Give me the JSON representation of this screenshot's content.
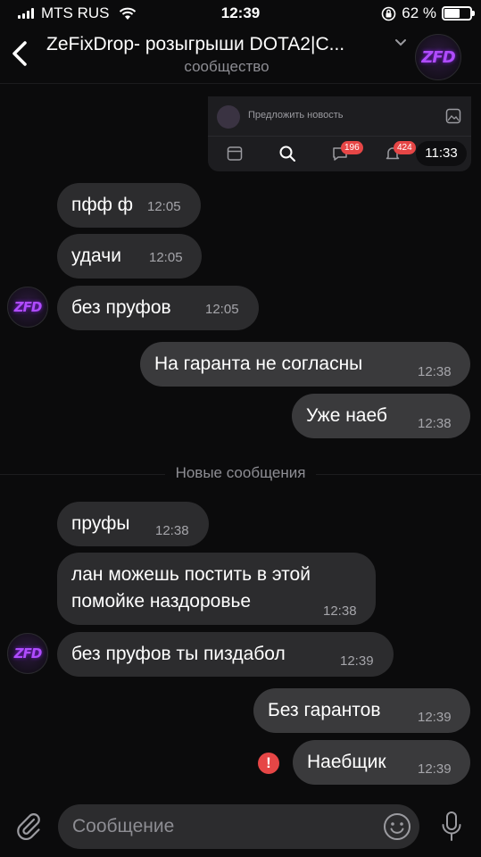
{
  "status_bar": {
    "carrier": "MTS RUS",
    "time": "12:39",
    "battery": "62 %",
    "battery_level": 0.62
  },
  "header": {
    "title": "ZeFixDrop- розыгрыши DOTA2|С...",
    "subtitle": "сообщество",
    "avatar_text": "ZFD"
  },
  "embedded_screenshot": {
    "suggest_news": "Предложить новость",
    "badge_messages": "196",
    "badge_notifications": "424",
    "time": "11:33"
  },
  "messages": [
    {
      "dir": "in",
      "text": "пфф ф",
      "time": "12:05"
    },
    {
      "dir": "in",
      "text": "удачи",
      "time": "12:05"
    },
    {
      "dir": "in",
      "text": "без пруфов",
      "time": "12:05"
    },
    {
      "dir": "out",
      "text": "На гаранта не согласны",
      "time": "12:38"
    },
    {
      "dir": "out",
      "text": "Уже наеб",
      "time": "12:38"
    },
    {
      "dir": "in",
      "text": "пруфы",
      "time": "12:38"
    },
    {
      "dir": "in",
      "text": "лан можешь постить в этой помойке наздоровье",
      "line1": "лан можешь постить в этой",
      "line2": "помойке наздоровье",
      "time": "12:38"
    },
    {
      "dir": "in",
      "text": "без пруфов ты пиздабол",
      "time": "12:39"
    },
    {
      "dir": "out",
      "text": "Без гарантов",
      "time": "12:39"
    },
    {
      "dir": "out",
      "text": "Наебщик",
      "time": "12:39",
      "error": "!"
    }
  ],
  "new_messages_label": "Новые сообщения",
  "composer": {
    "placeholder": "Сообщение"
  }
}
